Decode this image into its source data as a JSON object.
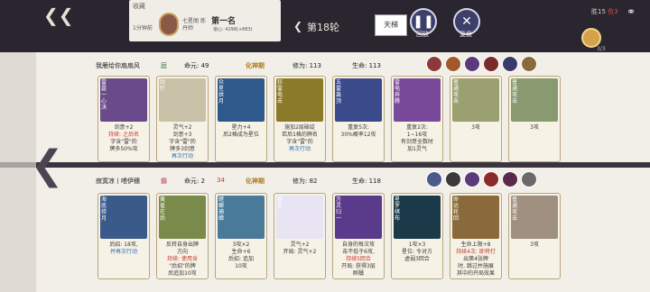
{
  "header": {
    "record_label": "收藏",
    "time": "1分钟前",
    "player_title": "七星阁 炼丹师",
    "rank": "第一名",
    "rank_sub": "道心: 4298(+883)",
    "rank_score": "",
    "ladder_button": "天梯",
    "round": "第18轮",
    "replay_label": "回放",
    "review_label": "复盘",
    "win_label": "胜15",
    "loss_label": "负3",
    "coin_count": "3/3"
  },
  "players": [
    {
      "name": "我雁给你扇扇风",
      "badge": "庭",
      "life": "命元: 49",
      "realm": "化神期",
      "cultivation": "修为: 113",
      "hp": "生命: 113",
      "cards": [
        {
          "name": "雷霆一心决",
          "lines": [
            "剑意+2",
            "持续: 之后名",
            "字含\"雷\"的",
            "牌多50%攻"
          ],
          "art": "#6a4a8a"
        },
        {
          "name": "剑针",
          "lines": [
            "灵气+2",
            "剑意+3",
            "字含\"雷\"的",
            "牌多3剑意",
            "再次行动"
          ],
          "art": "#c9c0a8"
        },
        {
          "name": "众星拱月",
          "lines": [
            "星力+4",
            "后2格成为星位"
          ],
          "art": "#2d5a8a"
        },
        {
          "name": "狂雷电击",
          "lines": [
            "施加2层破绽",
            "若后1格的牌名",
            "字含\"雷\"的",
            "再次行动"
          ],
          "art": "#8a7a2a"
        },
        {
          "name": "五雷轰顶",
          "lines": [
            "重复5次:",
            "30%概率12攻"
          ],
          "art": "#3a4a8a"
        },
        {
          "name": "雷电奔腾",
          "lines": [
            "重复2次:",
            "1~16攻",
            "有剑意全数时",
            "加1灵气"
          ],
          "art": "#7a4a9a"
        },
        {
          "name": "普通攻击",
          "lines": [
            "3攻"
          ],
          "art": "#9aa070"
        },
        {
          "name": "普通攻击",
          "lines": [
            "3攻"
          ],
          "art": "#8a9a70"
        }
      ]
    },
    {
      "name": "寂寞凉丨喂伊穗",
      "badge": "霸",
      "life": "命元: 2",
      "life_extra": "34",
      "realm": "化神期",
      "cultivation": "修为: 82",
      "hp": "生命: 118",
      "cards": [
        {
          "name": "海底捞月",
          "lines": [
            "后招: 18攻,",
            "并再次行动"
          ],
          "art": "#3a5a8a"
        },
        {
          "name": "黄雀在后",
          "lines": [
            "反转自身出牌",
            "方向",
            "持续: 使用含",
            "\"后招\"的牌",
            "后追加10攻"
          ],
          "art": "#7a8a4a"
        },
        {
          "name": "螳螂捕蝉",
          "lines": [
            "3攻×2",
            "生命+6",
            "后招: 追加",
            "10攻"
          ],
          "art": "#4a7a9a"
        },
        {
          "name": "探灵",
          "lines": [
            "灵气+2",
            "开局: 灵气+2"
          ],
          "art": "#e8e4f4"
        },
        {
          "name": "万灵归一",
          "lines": [
            "自身的每次攻",
            "击不低于6攻,",
            "持续5回合",
            "开局: 获得3层",
            "醉醺"
          ],
          "art": "#5a3a8a"
        },
        {
          "name": "星罗棋布",
          "lines": [
            "1攻×3",
            "星位: 令对方",
            "虚弱3回合"
          ],
          "art": "#1a3a4a"
        },
        {
          "name": "命运轮回",
          "lines": [
            "生命上限+8",
            "持续4次: 即将打",
            "出第4张牌",
            "时, 跳过并施展",
            "其中的开局效果"
          ],
          "art": "#8a6a3a"
        },
        {
          "name": "普通攻击",
          "lines": [
            "3攻"
          ],
          "art": "#a09080"
        }
      ]
    }
  ],
  "icons": {
    "back": "back-arrow-icon",
    "share": "share-icon",
    "replay": "play-icon",
    "review": "close-icon"
  }
}
